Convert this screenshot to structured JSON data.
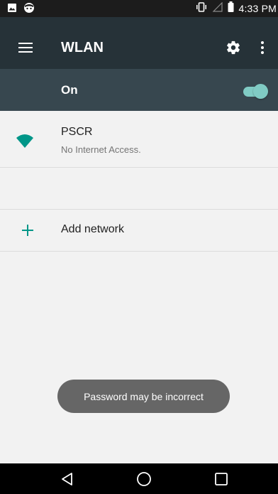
{
  "status_bar": {
    "time": "4:33 PM",
    "left_icons": [
      "image-icon",
      "face-icon"
    ],
    "right_icons": [
      "vibrate-icon",
      "signal-icon",
      "battery-icon"
    ]
  },
  "toolbar": {
    "title": "WLAN",
    "menu_icon": "menu-icon",
    "settings_icon": "gear-icon",
    "overflow_icon": "more-vert-icon",
    "color": "#263238"
  },
  "wlan_switch": {
    "label": "On",
    "checked": true,
    "accent": "#80cbc4"
  },
  "networks": [
    {
      "name": "PSCR",
      "status": "No Internet Access.",
      "icon": "wifi-icon",
      "icon_color": "#009688"
    }
  ],
  "add_network": {
    "label": "Add network",
    "icon": "plus-icon"
  },
  "toast": {
    "message": "Password may be incorrect"
  },
  "nav_bar": {
    "buttons": [
      "back-icon",
      "home-icon",
      "recents-icon"
    ]
  }
}
